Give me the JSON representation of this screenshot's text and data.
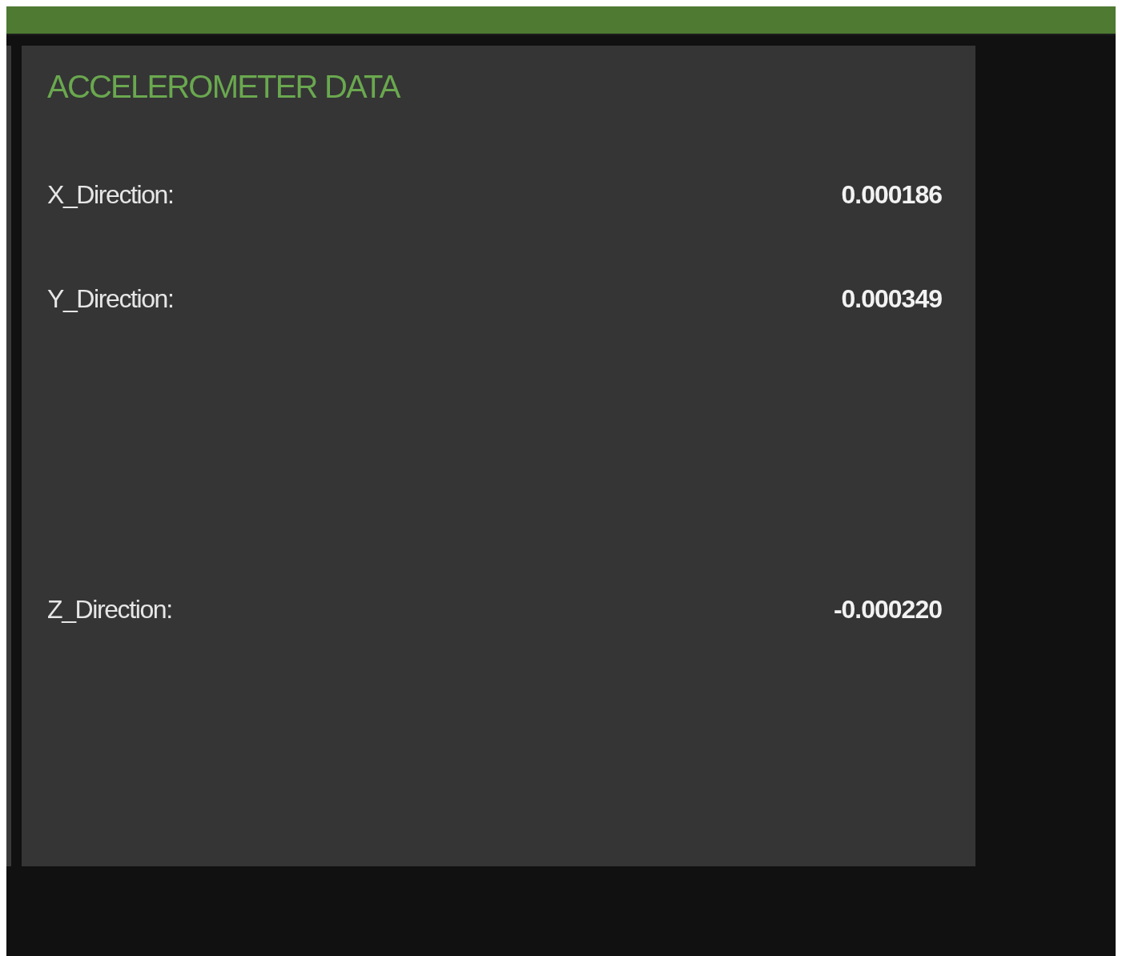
{
  "panel": {
    "title": "ACCELEROMETER DATA",
    "readings": [
      {
        "label": "X_Direction:",
        "value": "0.000186"
      },
      {
        "label": "Y_Direction:",
        "value": "0.000349"
      },
      {
        "label": "Z_Direction:",
        "value": "-0.000220"
      }
    ]
  }
}
